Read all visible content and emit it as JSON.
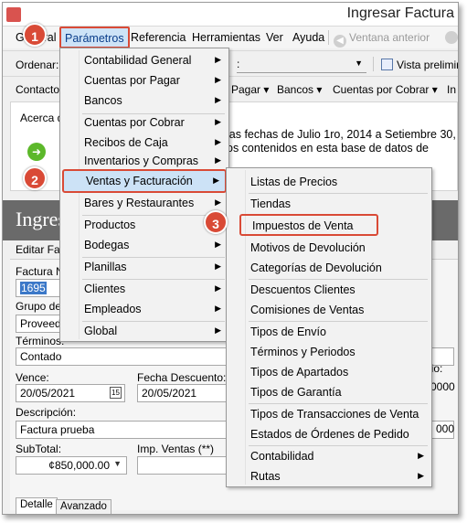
{
  "window": {
    "title": "Ingresar Factura"
  },
  "menubar": {
    "items": [
      "General",
      "Parámetros",
      "Referencia",
      "Herramientas",
      "Ver",
      "Ayuda"
    ],
    "nav_prev": "Ventana anterior"
  },
  "toolbar1": {
    "order_label": "Ordenar:",
    "order_value": ":",
    "preview": "Vista preliminar"
  },
  "toolbar2": {
    "items": [
      "Contactos",
      "Pagar",
      "Bancos",
      "Cuentas por Cobrar",
      "In"
    ]
  },
  "about": {
    "title": "Acerca de",
    "text_line1": "las fechas de Julio 1ro, 2014 a Setiembre 30,",
    "text_line2": "os contenidos en esta base de datos de"
  },
  "form_header": {
    "title": "Ingresar Factura",
    "edit_label": "Editar Factura"
  },
  "form": {
    "factura_label": "Factura No.",
    "factura_value": "1695",
    "grupo_label": "Grupo de",
    "grupo_value": "Proveedo",
    "terminos_label": "Términos:",
    "terminos_value": "Contado",
    "vence_label": "Vence:",
    "vence_value": "20/05/2021",
    "fecha_desc_label": "Fecha Descuento:",
    "fecha_desc_value": "20/05/2021",
    "descripcion_label": "Descripción:",
    "descripcion_value": "Factura prueba",
    "subtotal_label": "SubTotal:",
    "subtotal_value": "¢850,000.00",
    "imp_label": "Imp. Ventas (**)",
    "right_cambio": "bio:",
    "right_num1": "0000",
    "right_num2": "000",
    "calendar_glyph": "15"
  },
  "tabs": [
    "Detalle",
    "Avanzado"
  ],
  "parametros_menu": [
    "Contabilidad General",
    "Cuentas por Pagar",
    "Bancos",
    "Cuentas por Cobrar",
    "Recibos de Caja",
    "Inventarios y Compras",
    "Ventas y Facturación",
    "Bares y Restaurantes",
    "Productos",
    "Bodegas",
    "Planillas",
    "Clientes",
    "Empleados",
    "Global"
  ],
  "ventas_submenu": [
    "Listas de Precios",
    "Tiendas",
    "Impuestos de Venta",
    "Motivos de Devolución",
    "Categorías de Devolución",
    "Descuentos Clientes",
    "Comisiones de Ventas",
    "Tipos de Envío",
    "Términos y Periodos",
    "Tipos de Apartados",
    "Tipos de Garantía",
    "Tipos de Transacciones de Venta",
    "Estados de Órdenes de Pedido",
    "Contabilidad",
    "Rutas"
  ],
  "badges": [
    "1",
    "2",
    "3"
  ],
  "colors": {
    "annotation_red": "#d94a36",
    "highlight_blue": "#cce2f6",
    "header_gray": "#6a6a6a"
  }
}
